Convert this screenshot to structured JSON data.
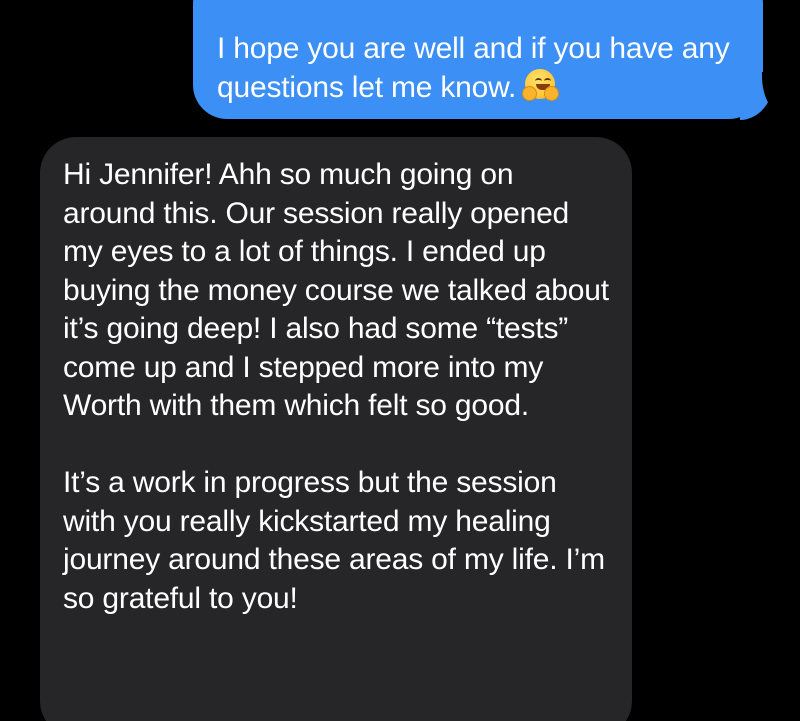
{
  "conversation": {
    "sent_message": {
      "text": "I hope you are well and if you have any questions let me know.",
      "emoji": "hugging-face-emoji",
      "bubble_color": "#3b8ff5"
    },
    "received_message": {
      "paragraph_1": "Hi Jennifer! Ahh so much going on around this. Our session really opened my eyes to a lot of things. I ended up buying the money course we talked about it’s going deep! I also had some “tests” come up and I stepped more into my Worth with them which felt so good.",
      "paragraph_2": "It’s a work in progress but the session with you really kickstarted my healing journey around these areas of my life. I’m so grateful to you!",
      "bubble_color": "#262628"
    },
    "background_color": "#000000"
  }
}
